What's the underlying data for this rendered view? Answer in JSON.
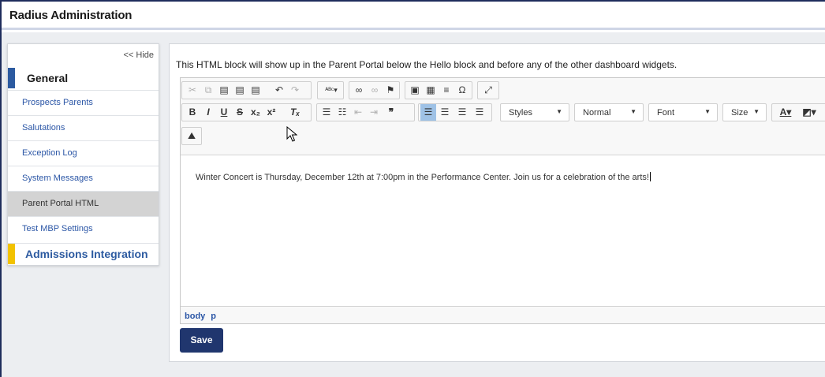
{
  "app": {
    "title": "Radius Administration"
  },
  "sidebar": {
    "hide_label": "<< Hide",
    "sections": [
      {
        "label": "General",
        "accent": "#2c5aa0"
      },
      {
        "label": "Admissions Integration",
        "accent": "#f2c200"
      }
    ],
    "items": [
      {
        "label": "Prospects Parents",
        "active": false
      },
      {
        "label": "Salutations",
        "active": false
      },
      {
        "label": "Exception Log",
        "active": false
      },
      {
        "label": "System Messages",
        "active": false
      },
      {
        "label": "Parent Portal HTML",
        "active": true
      },
      {
        "label": "Test MBP Settings",
        "active": false
      }
    ]
  },
  "main": {
    "description": "This HTML block will show up in the Parent Portal below the Hello block and before any of the other dashboard widgets.",
    "editor": {
      "combos": {
        "styles": "Styles",
        "format": "Normal",
        "font": "Font",
        "size": "Size"
      },
      "content": "Winter Concert is Thursday, December 12th at 7:00pm in the Performance Center. Join us for a celebration of the arts!",
      "path": [
        "body",
        "p"
      ]
    },
    "save_label": "Save"
  },
  "colors": {
    "brand_dark": "#20366e",
    "link": "#2b56a6",
    "active_item": "#d3d3d3"
  }
}
